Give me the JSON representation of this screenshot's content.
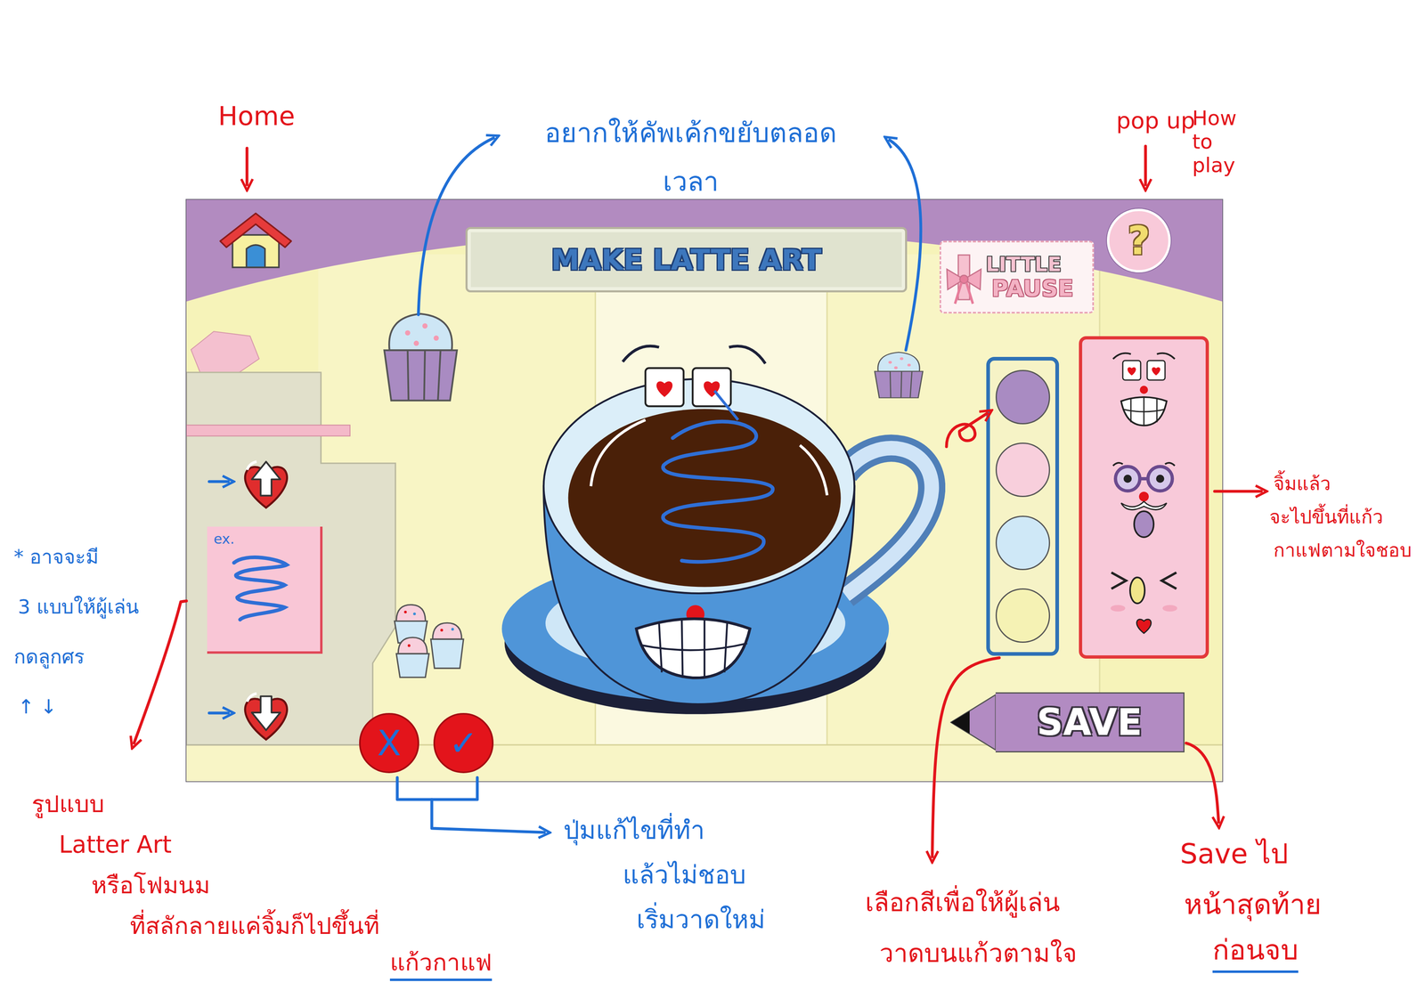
{
  "game": {
    "title": "MAKE LATTE ART",
    "logo": [
      "LITTLE",
      "PAUSE"
    ],
    "help_button": "?",
    "pattern_picker": {
      "example_label": "ex."
    },
    "edit_buttons": [
      {
        "label": "X"
      },
      {
        "label": "✓"
      }
    ],
    "palette": [
      {
        "color": "#a98bc2"
      },
      {
        "color": "#f8cfdc"
      },
      {
        "color": "#cfe8f7"
      },
      {
        "color": "#f5f2b4"
      }
    ],
    "faces": [
      {
        "kind": "hearts"
      },
      {
        "kind": "glasses"
      },
      {
        "kind": "wink"
      }
    ],
    "save_button": "SAVE"
  },
  "annotations": [
    {
      "color": "#e3141b",
      "lines": [
        "Home"
      ]
    },
    {
      "color": "#e3141b",
      "lines": [
        "pop up"
      ]
    },
    {
      "color": "#e3141b",
      "lines": [
        "How",
        "to",
        "play"
      ]
    },
    {
      "color": "#1f6fd6",
      "lines": [
        "อยากให้คัพเค้กขยับตลอด",
        "เวลา"
      ]
    },
    {
      "color": "#1f6fd6",
      "lines": [
        "* อาจจะมี",
        "3 แบบให้ผู้เล่น",
        "กดลูกศร",
        "↑ ↓"
      ]
    },
    {
      "color": "#e3141b",
      "lines": [
        "รูปแบบ",
        "Latter Art",
        "หรือโฟมนม",
        "ที่สลักลายแค่จิ้มก็ไปขึ้นที่",
        "แก้วกาแฟ"
      ]
    },
    {
      "color": "#1f6fd6",
      "lines": [
        "ปุ่มแก้ไขที่ทำ",
        "แล้วไม่ชอบ",
        "เริ่มวาดใหม่"
      ]
    },
    {
      "color": "#e3141b",
      "lines": [
        "เลือกสีเพื่อให้ผู้เล่น",
        "วาดบนแก้วตามใจ"
      ]
    },
    {
      "color": "#e3141b",
      "lines": [
        "Save ไป",
        "หน้าสุดท้าย",
        "ก่อนจบ"
      ]
    },
    {
      "color": "#e3141b",
      "lines": [
        "จิ้มแล้ว",
        "จะไปขึ้นที่แก้ว",
        "กาแฟตามใจชอบ"
      ]
    }
  ]
}
